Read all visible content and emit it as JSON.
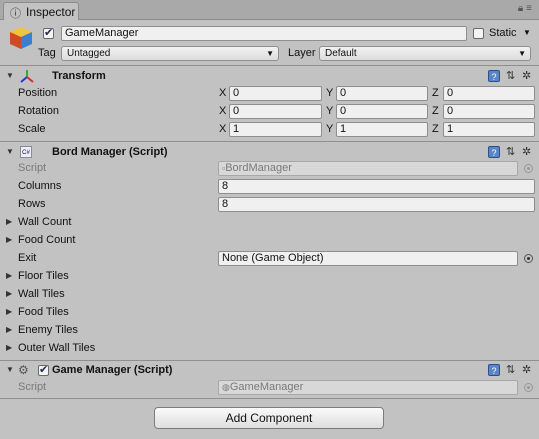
{
  "tab": {
    "label": "Inspector",
    "icon": "info-icon"
  },
  "window_controls": {
    "lock": "lock-icon",
    "menu": "menu-icon"
  },
  "object": {
    "name": "GameManager",
    "active": true,
    "static_label": "Static",
    "static": false,
    "tag_label": "Tag",
    "tag_value": "Untagged",
    "layer_label": "Layer",
    "layer_value": "Default"
  },
  "transform": {
    "title": "Transform",
    "rows": [
      {
        "label": "Position",
        "x": "0",
        "y": "0",
        "z": "0"
      },
      {
        "label": "Rotation",
        "x": "0",
        "y": "0",
        "z": "0"
      },
      {
        "label": "Scale",
        "x": "1",
        "y": "1",
        "z": "1"
      }
    ],
    "axis_x": "X",
    "axis_y": "Y",
    "axis_z": "Z"
  },
  "bord_manager": {
    "title": "Bord Manager (Script)",
    "script_label": "Script",
    "script_value": "BordManager",
    "columns_label": "Columns",
    "columns_value": "8",
    "rows_label": "Rows",
    "rows_value": "8",
    "wall_count_label": "Wall Count",
    "food_count_label": "Food Count",
    "exit_label": "Exit",
    "exit_value": "None (Game Object)",
    "floor_tiles_label": "Floor Tiles",
    "wall_tiles_label": "Wall Tiles",
    "food_tiles_label": "Food Tiles",
    "enemy_tiles_label": "Enemy Tiles",
    "outer_wall_tiles_label": "Outer Wall Tiles"
  },
  "game_manager": {
    "title": "Game Manager (Script)",
    "enabled": true,
    "script_label": "Script",
    "script_value": "GameManager"
  },
  "add_component_label": "Add Component",
  "colors": {
    "background": "#c2c2c2",
    "tabbar": "#a9a9a9",
    "help_icon": "#5a86c8"
  }
}
